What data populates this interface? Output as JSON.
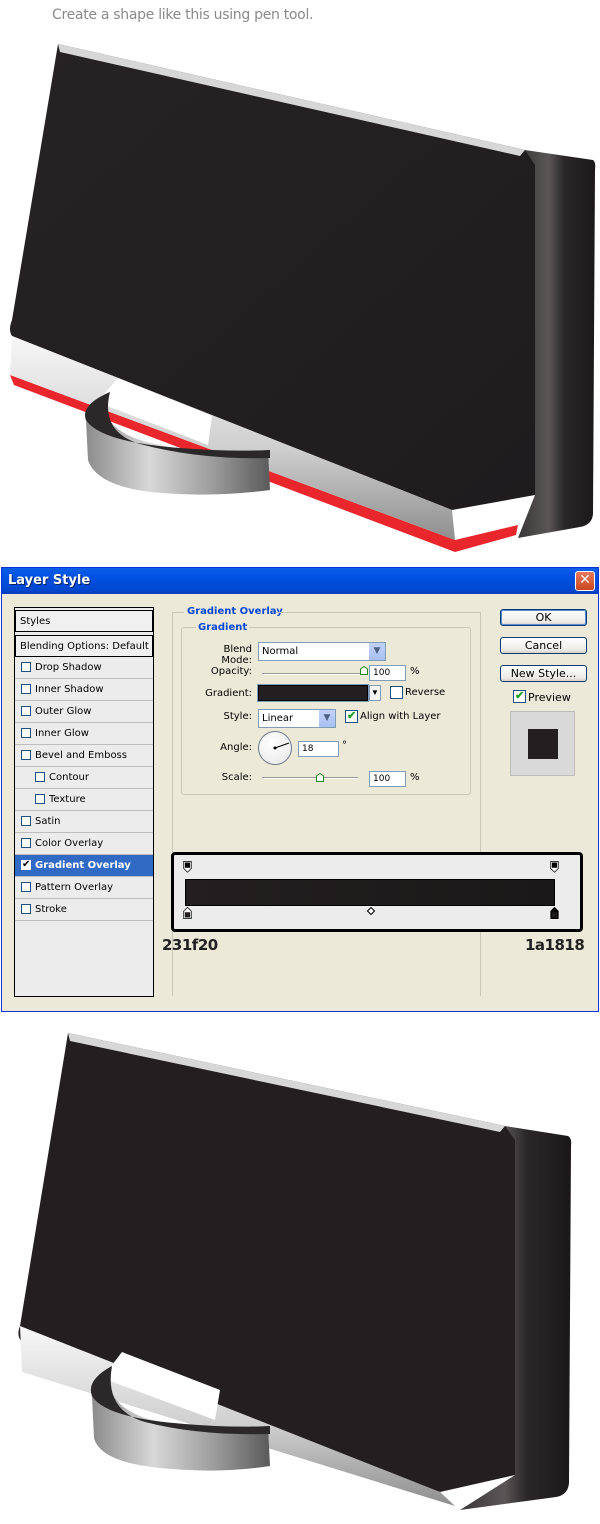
{
  "caption": "Create a shape like this using pen tool.",
  "colors": {
    "speaker_body": "#262324",
    "speaker_side": "#1e1c1d",
    "red_strip": "#e8262b",
    "silver_light": "#f2f2f2",
    "silver_dark": "#8c8c8c",
    "xp_title": "#0050e0",
    "dialog_bg": "#ece9d8",
    "selected_item": "#316ac5"
  },
  "dialog": {
    "title": "Layer Style",
    "close_icon": "close-icon",
    "styles_list": [
      {
        "label": "Styles",
        "type": "head"
      },
      {
        "label": "Blending Options: Default",
        "type": "head"
      },
      {
        "label": "Drop Shadow",
        "checked": false
      },
      {
        "label": "Inner Shadow",
        "checked": false
      },
      {
        "label": "Outer Glow",
        "checked": false
      },
      {
        "label": "Inner Glow",
        "checked": false
      },
      {
        "label": "Bevel and Emboss",
        "checked": false
      },
      {
        "label": "Contour",
        "checked": false,
        "indent": true
      },
      {
        "label": "Texture",
        "checked": false,
        "indent": true
      },
      {
        "label": "Satin",
        "checked": false
      },
      {
        "label": "Color Overlay",
        "checked": false
      },
      {
        "label": "Gradient Overlay",
        "checked": true,
        "selected": true
      },
      {
        "label": "Pattern Overlay",
        "checked": false
      },
      {
        "label": "Stroke",
        "checked": false
      }
    ],
    "section_title": "Gradient Overlay",
    "group_title": "Gradient",
    "blend_mode_label": "Blend Mode:",
    "blend_mode_value": "Normal",
    "opacity_label": "Opacity:",
    "opacity_value": "100",
    "opacity_unit": "%",
    "opacity_level": 1.0,
    "gradient_label": "Gradient:",
    "reverse_label": "Reverse",
    "reverse_checked": false,
    "style_label": "Style:",
    "style_value": "Linear",
    "align_label": "Align with Layer",
    "align_checked": true,
    "angle_label": "Angle:",
    "angle_value": "18",
    "angle_unit": "°",
    "scale_label": "Scale:",
    "scale_value": "100",
    "scale_unit": "%",
    "scale_level": 0.6,
    "ok_label": "OK",
    "cancel_label": "Cancel",
    "new_style_label": "New Style...",
    "preview_label": "Preview",
    "preview_checked": true
  },
  "gradient_editor": {
    "left_color": "231f20",
    "right_color": "1a1818",
    "left_hex": "#231f20",
    "right_hex": "#1a1818"
  }
}
